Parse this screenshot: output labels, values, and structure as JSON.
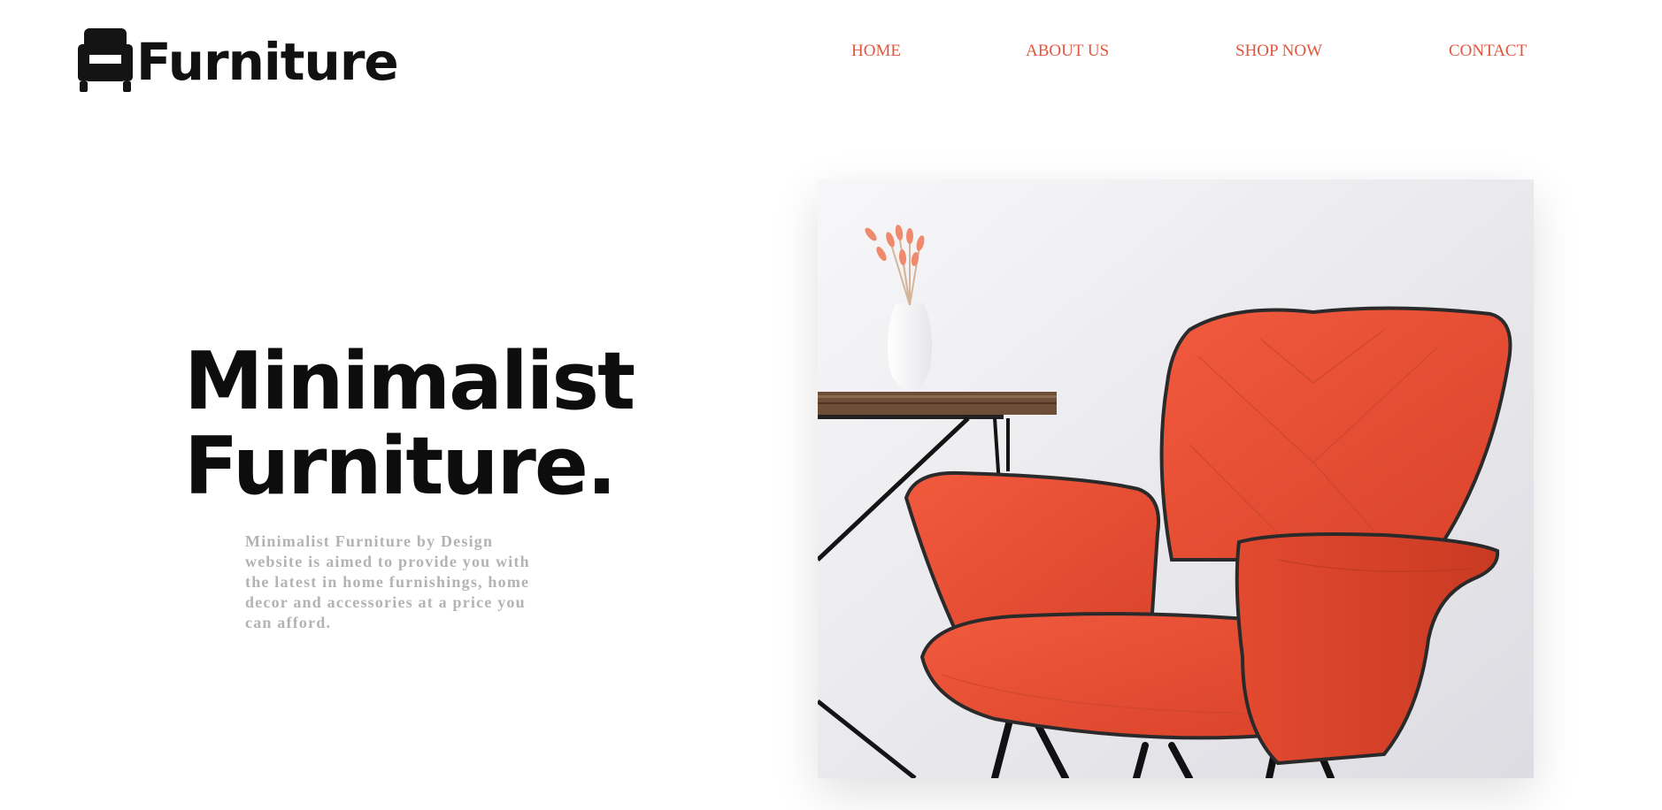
{
  "header": {
    "logo_text": "Furniture",
    "logo_icon": "armchair-icon"
  },
  "nav": {
    "home": "HOME",
    "about": "ABOUT US",
    "shop": "SHOP NOW",
    "contact": "CONTACT"
  },
  "hero": {
    "title_line1": "Minimalist",
    "title_line2": "Furniture.",
    "description": "Minimalist Furniture by Design website is aimed to provide you with the latest in home furnishings, home decor and accessories at a price you can afford."
  },
  "colors": {
    "accent": "#e0573d",
    "chair": "#ee5236",
    "text_dark": "#0d0d0d",
    "text_muted": "#b3b3b3"
  }
}
